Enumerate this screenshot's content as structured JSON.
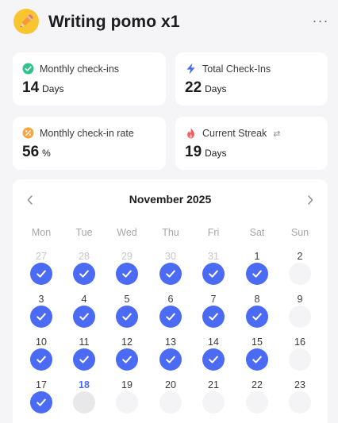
{
  "header": {
    "title": "Writing pomo x1",
    "more_label": "···",
    "icon": "pencil-icon"
  },
  "stats": [
    {
      "key": "monthly_checkins",
      "label": "Monthly check-ins",
      "value": "14",
      "unit": "Days",
      "icon": "check-circle-icon",
      "color": "#2fc38c"
    },
    {
      "key": "total_checkins",
      "label": "Total Check-Ins",
      "value": "22",
      "unit": "Days",
      "icon": "lightning-icon",
      "color": "#4b6bf4"
    },
    {
      "key": "monthly_rate",
      "label": "Monthly check-in rate",
      "value": "56",
      "unit": "%",
      "icon": "percent-circle-icon",
      "color": "#f5a742"
    },
    {
      "key": "current_streak",
      "label": "Current Streak",
      "value": "19",
      "unit": "Days",
      "icon": "flame-icon",
      "color": "#f25b5b",
      "extra": "⇄"
    }
  ],
  "calendar": {
    "month_label": "November 2025",
    "weekdays": [
      "Mon",
      "Tue",
      "Wed",
      "Thu",
      "Fri",
      "Sat",
      "Sun"
    ],
    "today": "18",
    "accent": "#4b6bf4",
    "weeks": [
      [
        {
          "day": "27",
          "state": "done",
          "outside": true
        },
        {
          "day": "28",
          "state": "done",
          "outside": true
        },
        {
          "day": "29",
          "state": "done",
          "outside": true
        },
        {
          "day": "30",
          "state": "done",
          "outside": true
        },
        {
          "day": "31",
          "state": "done",
          "outside": true
        },
        {
          "day": "1",
          "state": "done"
        },
        {
          "day": "2",
          "state": "empty"
        }
      ],
      [
        {
          "day": "3",
          "state": "done"
        },
        {
          "day": "4",
          "state": "done"
        },
        {
          "day": "5",
          "state": "done"
        },
        {
          "day": "6",
          "state": "done"
        },
        {
          "day": "7",
          "state": "done"
        },
        {
          "day": "8",
          "state": "done"
        },
        {
          "day": "9",
          "state": "empty"
        }
      ],
      [
        {
          "day": "10",
          "state": "done"
        },
        {
          "day": "11",
          "state": "done"
        },
        {
          "day": "12",
          "state": "done"
        },
        {
          "day": "13",
          "state": "done"
        },
        {
          "day": "14",
          "state": "done"
        },
        {
          "day": "15",
          "state": "done"
        },
        {
          "day": "16",
          "state": "empty"
        }
      ],
      [
        {
          "day": "17",
          "state": "done"
        },
        {
          "day": "18",
          "state": "today"
        },
        {
          "day": "19",
          "state": "empty"
        },
        {
          "day": "20",
          "state": "empty"
        },
        {
          "day": "21",
          "state": "empty"
        },
        {
          "day": "22",
          "state": "empty"
        },
        {
          "day": "23",
          "state": "empty"
        }
      ]
    ]
  }
}
